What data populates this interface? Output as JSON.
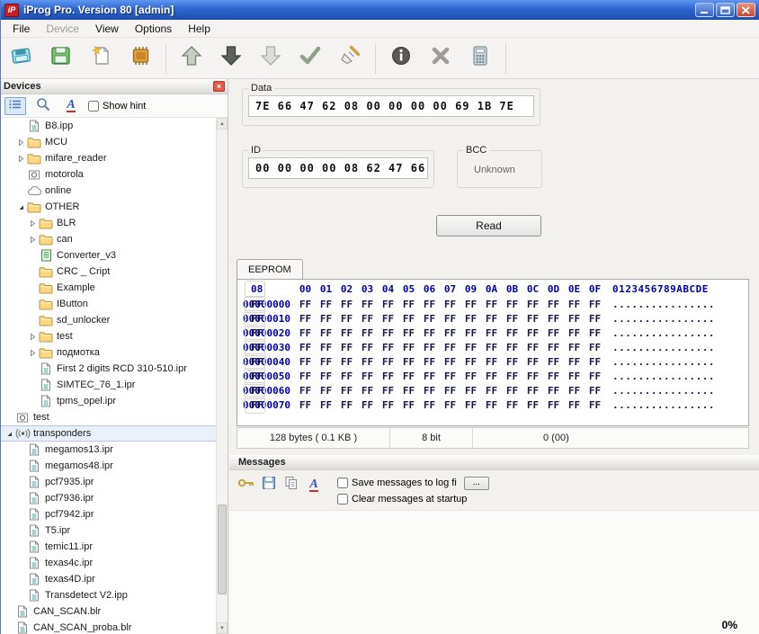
{
  "window": {
    "title": "iProg Pro. Version 80 [admin]",
    "icon_text": "iP"
  },
  "menu": {
    "items": [
      {
        "label": "File",
        "enabled": true
      },
      {
        "label": "Device",
        "enabled": false
      },
      {
        "label": "View",
        "enabled": true
      },
      {
        "label": "Options",
        "enabled": true
      },
      {
        "label": "Help",
        "enabled": true
      }
    ]
  },
  "toolbar": {
    "icons": [
      "open-file",
      "save-file",
      "new-file",
      "chip",
      "arrow-up",
      "arrow-down",
      "arrow-down-disabled",
      "check",
      "brush",
      "info",
      "cancel-x",
      "calculator"
    ]
  },
  "devices_panel": {
    "title": "Devices",
    "show_hint_label": "Show hint",
    "toolbar_icons": [
      "tree-view",
      "search",
      "font"
    ],
    "tree": [
      {
        "label": "B8.ipp",
        "depth": 1,
        "icon": "file",
        "expander": null
      },
      {
        "label": "MCU",
        "depth": 1,
        "icon": "folder",
        "expander": "collapsed"
      },
      {
        "label": "mifare_reader",
        "depth": 1,
        "icon": "folder",
        "expander": "collapsed"
      },
      {
        "label": "motorola",
        "depth": 1,
        "icon": "device",
        "expander": null
      },
      {
        "label": "online",
        "depth": 1,
        "icon": "cloud",
        "expander": null
      },
      {
        "label": "OTHER",
        "depth": 1,
        "icon": "folder",
        "expander": "expanded"
      },
      {
        "label": "BLR",
        "depth": 2,
        "icon": "folder",
        "expander": "collapsed"
      },
      {
        "label": "can",
        "depth": 2,
        "icon": "folder",
        "expander": "collapsed"
      },
      {
        "label": "Converter_v3",
        "depth": 2,
        "icon": "converter",
        "expander": null
      },
      {
        "label": "CRC _ Cript",
        "depth": 2,
        "icon": "folder",
        "expander": null
      },
      {
        "label": "Example",
        "depth": 2,
        "icon": "folder",
        "expander": null
      },
      {
        "label": "IButton",
        "depth": 2,
        "icon": "folder",
        "expander": null
      },
      {
        "label": "sd_unlocker",
        "depth": 2,
        "icon": "folder",
        "expander": null
      },
      {
        "label": "test",
        "depth": 2,
        "icon": "folder",
        "expander": "collapsed"
      },
      {
        "label": "подмотка",
        "depth": 2,
        "icon": "folder",
        "expander": "collapsed"
      },
      {
        "label": "First 2 digits RCD 310-510.ipr",
        "depth": 2,
        "icon": "file",
        "expander": null
      },
      {
        "label": "SIMTEC_76_1.ipr",
        "depth": 2,
        "icon": "file",
        "expander": null
      },
      {
        "label": "tpms_opel.ipr",
        "depth": 2,
        "icon": "file",
        "expander": null
      },
      {
        "label": "test",
        "depth": 0,
        "icon": "device",
        "expander": null
      },
      {
        "label": "transponders",
        "depth": 0,
        "icon": "antenna",
        "expander": "expanded",
        "selected": true
      },
      {
        "label": "megamos13.ipr",
        "depth": 1,
        "icon": "file",
        "expander": null
      },
      {
        "label": "megamos48.ipr",
        "depth": 1,
        "icon": "file",
        "expander": null
      },
      {
        "label": "pcf7935.ipr",
        "depth": 1,
        "icon": "file",
        "expander": null
      },
      {
        "label": "pcf7936.ipr",
        "depth": 1,
        "icon": "file",
        "expander": null
      },
      {
        "label": "pcf7942.ipr",
        "depth": 1,
        "icon": "file",
        "expander": null
      },
      {
        "label": "T5.ipr",
        "depth": 1,
        "icon": "file",
        "expander": null
      },
      {
        "label": "temic11.ipr",
        "depth": 1,
        "icon": "file",
        "expander": null
      },
      {
        "label": "texas4c.ipr",
        "depth": 1,
        "icon": "file",
        "expander": null
      },
      {
        "label": "texas4D.ipr",
        "depth": 1,
        "icon": "file",
        "expander": null
      },
      {
        "label": "Transdetect V2.ipp",
        "depth": 1,
        "icon": "file",
        "expander": null
      },
      {
        "label": "CAN_SCAN.blr",
        "depth": 0,
        "icon": "file",
        "expander": null
      },
      {
        "label": "CAN_SCAN_proba.blr",
        "depth": 0,
        "icon": "file",
        "expander": null
      }
    ]
  },
  "data_group": {
    "label": "Data",
    "value": "7E 66 47 62 08 00 00 00 00 69 1B 7E"
  },
  "id_group": {
    "label": "ID",
    "value": "00 00 00 00 08 62 47 66"
  },
  "bcc_group": {
    "label": "BCC",
    "value": "Unknown"
  },
  "read_button_label": "Read",
  "eeprom": {
    "tab_label": "EEPROM",
    "byte_columns": [
      "00",
      "01",
      "02",
      "03",
      "04",
      "05",
      "06",
      "07",
      "08",
      "09",
      "0A",
      "0B",
      "0C",
      "0D",
      "0E",
      "0F"
    ],
    "ascii_header": "0123456789ABCDE",
    "rows": [
      {
        "addr": "00000000",
        "bytes": "FF FF FF FF FF FF FF FF FF FF FF FF FF FF FF FF",
        "ascii": "................"
      },
      {
        "addr": "00000010",
        "bytes": "FF FF FF FF FF FF FF FF FF FF FF FF FF FF FF FF",
        "ascii": "................"
      },
      {
        "addr": "00000020",
        "bytes": "FF FF FF FF FF FF FF FF FF FF FF FF FF FF FF FF",
        "ascii": "................"
      },
      {
        "addr": "00000030",
        "bytes": "FF FF FF FF FF FF FF FF FF FF FF FF FF FF FF FF",
        "ascii": "................"
      },
      {
        "addr": "00000040",
        "bytes": "FF FF FF FF FF FF FF FF FF FF FF FF FF FF FF FF",
        "ascii": "................"
      },
      {
        "addr": "00000050",
        "bytes": "FF FF FF FF FF FF FF FF FF FF FF FF FF FF FF FF",
        "ascii": "................"
      },
      {
        "addr": "00000060",
        "bytes": "FF FF FF FF FF FF FF FF FF FF FF FF FF FF FF FF",
        "ascii": "................"
      },
      {
        "addr": "00000070",
        "bytes": "FF FF FF FF FF FF FF FF FF FF FF FF FF FF FF FF",
        "ascii": "................"
      }
    ],
    "status": {
      "size": "128 bytes ( 0.1 KB )",
      "bits": "8 bit",
      "value": "0 (00)"
    }
  },
  "messages": {
    "title": "Messages",
    "toolbar_icons": [
      "clear-log",
      "save-log",
      "copy",
      "font"
    ],
    "save_log_label": "Save messages to log fi",
    "browse_label": "...",
    "clear_label": "Clear messages at startup",
    "progress": "0%"
  }
}
